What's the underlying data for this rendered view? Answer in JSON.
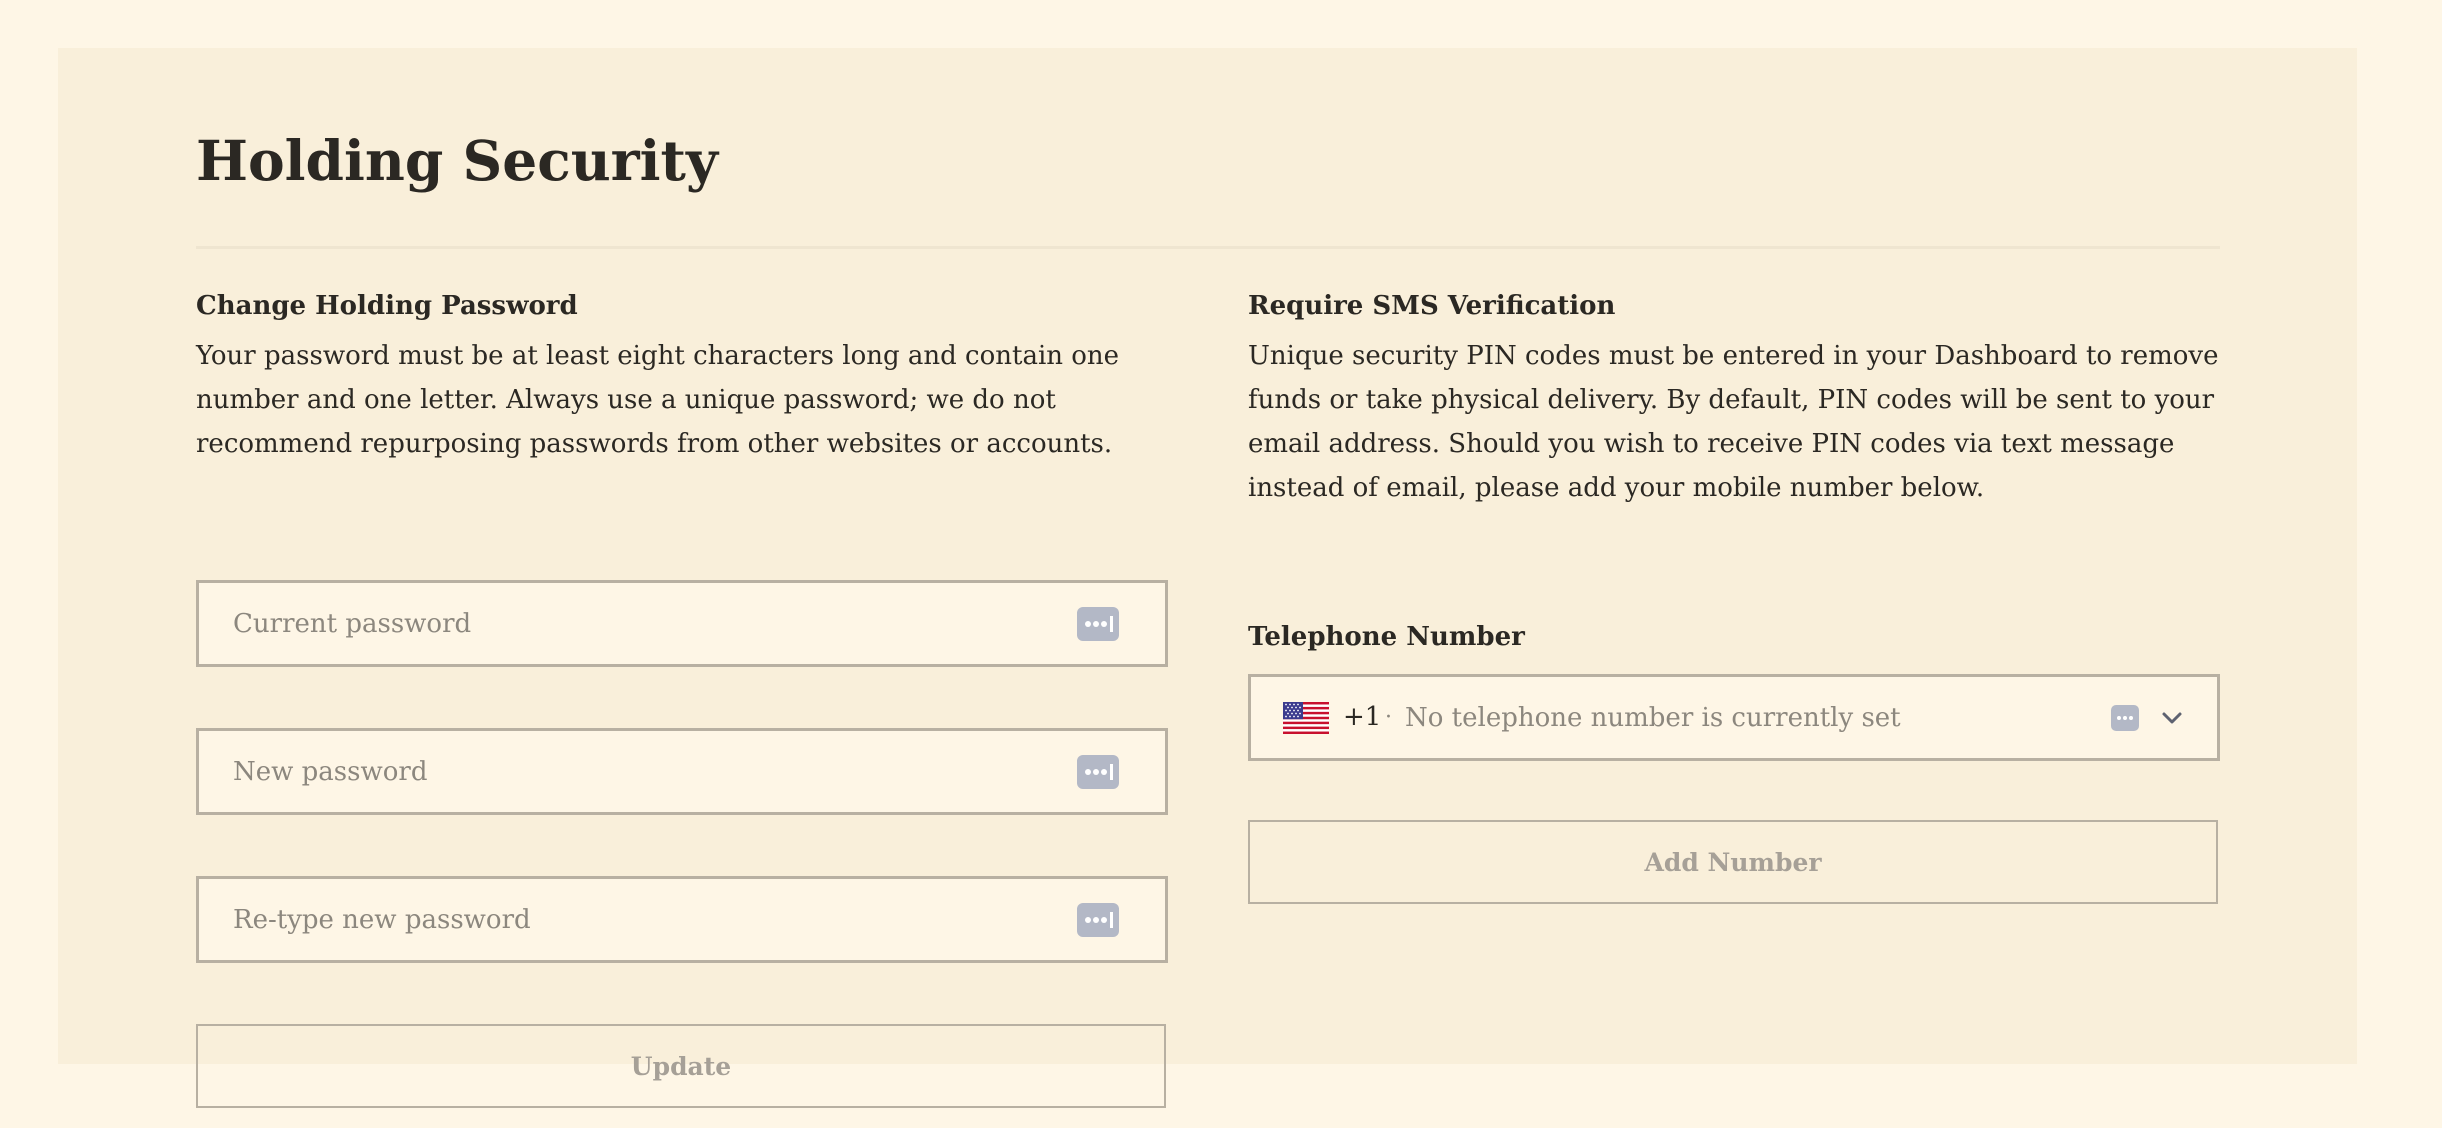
{
  "page": {
    "title": "Holding Security"
  },
  "password_section": {
    "title": "Change Holding Password",
    "description": "Your password must be at least eight characters long and contain one number and one letter. Always use a unique password; we do not recommend repurposing passwords from other websites or accounts.",
    "current_password_placeholder": "Current password",
    "new_password_placeholder": "New password",
    "retype_password_placeholder": "Re-type new password",
    "update_label": "Update"
  },
  "sms_section": {
    "title": "Require SMS Verification",
    "description": "Unique security PIN codes must be entered in your Dashboard to remove funds or take physical delivery. By default, PIN codes will be sent to your email address. Should you wish to receive PIN codes via text message instead of email, please add your mobile number below.",
    "telephone_label": "Telephone Number",
    "country_flag": "us-flag-icon",
    "dial_code": "+1",
    "dial_separator": "·",
    "telephone_placeholder": "No telephone number is currently set",
    "add_number_label": "Add Number"
  },
  "colors": {
    "page_background": "#fef6e6",
    "panel_background": "#f9efda",
    "input_border": "#b8b0a2",
    "disabled_button_text": "#a6a097",
    "password_manager_icon": "#b3b8c6"
  }
}
